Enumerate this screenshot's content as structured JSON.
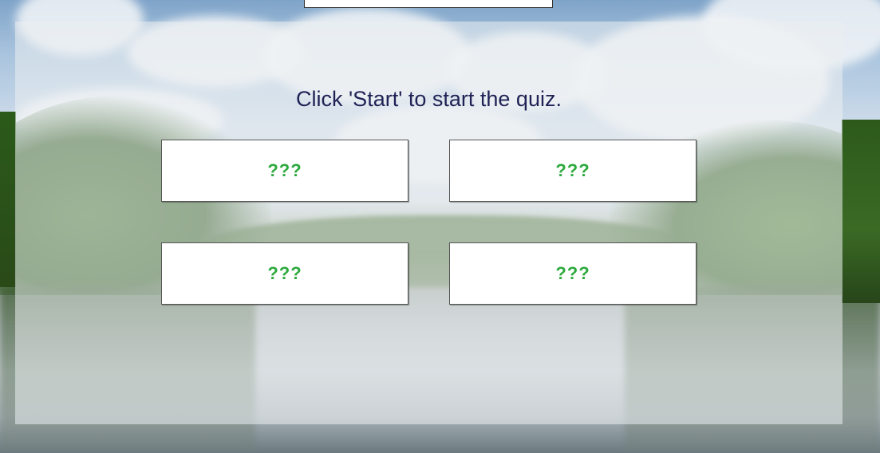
{
  "quiz": {
    "prompt": "Click 'Start' to start the quiz.",
    "answers": [
      {
        "label": "???"
      },
      {
        "label": "???"
      },
      {
        "label": "???"
      },
      {
        "label": "???"
      }
    ]
  },
  "colors": {
    "prompt_text": "#1f2255",
    "answer_text": "#2daa3e",
    "answer_bg": "#ffffff"
  }
}
